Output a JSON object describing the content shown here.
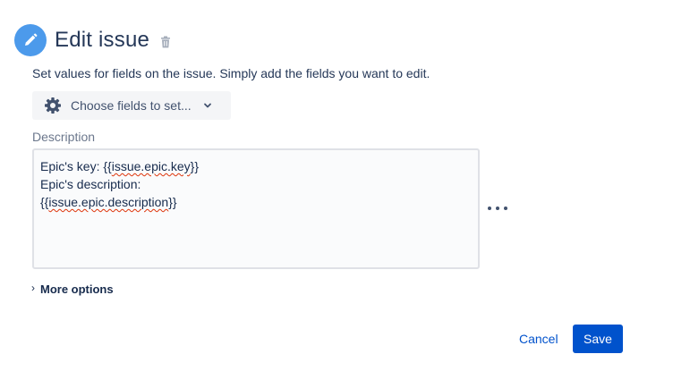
{
  "header": {
    "title": "Edit issue",
    "edit_icon": "pencil-icon",
    "delete_icon": "trash-icon"
  },
  "subtitle": "Set values for fields on the issue. Simply add the fields you want to edit.",
  "choose_fields": {
    "label": "Choose fields to set...",
    "icon": "gear-icon",
    "dropdown_icon": "chevron-down-icon"
  },
  "description": {
    "label": "Description",
    "line1_prefix": "Epic's key: {{",
    "line1_var": "issue.epic.key",
    "line1_suffix": "}}",
    "line2": "Epic's description:",
    "line3_prefix": "{{",
    "line3_var": "issue.epic.description",
    "line3_suffix": "}}"
  },
  "more_menu_icon": "more-icon",
  "more_options": {
    "label": "More options",
    "icon": "chevron-right-icon"
  },
  "buttons": {
    "cancel": "Cancel",
    "save": "Save"
  },
  "colors": {
    "accent": "#0052cc",
    "edit_circle": "#4c9aeb",
    "spell_underline": "#de350b"
  }
}
